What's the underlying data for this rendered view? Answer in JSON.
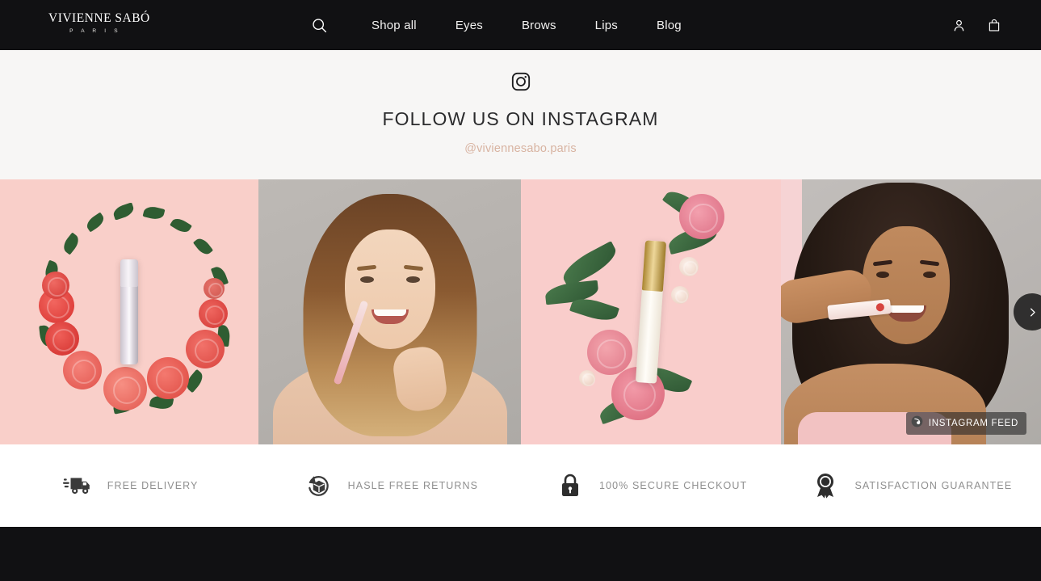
{
  "header": {
    "logo": {
      "main": "VIVIENNE SABÓ",
      "sub": "P A R I S"
    },
    "search_icon": "search-icon",
    "nav": [
      {
        "label": "Shop all"
      },
      {
        "label": "Eyes"
      },
      {
        "label": "Brows"
      },
      {
        "label": "Lips"
      },
      {
        "label": "Blog"
      }
    ],
    "account_icon": "user-icon",
    "cart_icon": "shopping-bag-icon",
    "background": "#111113"
  },
  "instagram": {
    "glyph": "instagram-icon",
    "title": "FOLLOW US ON INSTAGRAM",
    "handle": "@viviennesabo.paris",
    "handle_color": "#d8b3a1",
    "background": "#f7f6f5",
    "feed_badge": {
      "label": "INSTAGRAM FEED",
      "icon": "instagram-feed-icon"
    },
    "next_arrow": "chevron-right-icon",
    "tiles": [
      {
        "alt": "Silver mascara tube inside a wreath of red roses on pink background"
      },
      {
        "alt": "Smiling woman with long auburn hair holding a pink lip pencil"
      },
      {
        "alt": "White and gold mascara tube with pink roses and eucalyptus leaves"
      },
      {
        "alt": "Smiling woman with curly dark hair holding a lip product"
      }
    ]
  },
  "trust_bar": [
    {
      "label": "FREE DELIVERY",
      "icon": "delivery-truck-icon"
    },
    {
      "label": "HASLE FREE RETURNS",
      "icon": "return-box-icon"
    },
    {
      "label": "100% SECURE CHECKOUT",
      "icon": "lock-icon"
    },
    {
      "label": "SATISFACTION GUARANTEE",
      "icon": "award-ribbon-icon"
    }
  ],
  "footer": {
    "background": "#111113"
  }
}
